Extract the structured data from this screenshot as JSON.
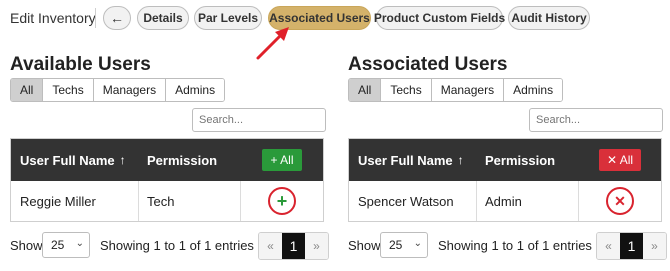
{
  "topbar": {
    "page_label": "Edit Inventory",
    "back_glyph": "←",
    "tabs": [
      {
        "label": "Details",
        "active": false
      },
      {
        "label": "Par Levels",
        "active": false
      },
      {
        "label": "Associated Users",
        "active": true
      },
      {
        "label": "Product Custom Fields",
        "active": false
      },
      {
        "label": "Audit History",
        "active": false
      }
    ],
    "active_color": "#d4b26a"
  },
  "annotation": {
    "icon": "red-arrow-icon",
    "color": "#e0202a"
  },
  "available": {
    "title": "Available Users",
    "filters": [
      "All",
      "Techs",
      "Managers",
      "Admins"
    ],
    "selected_filter": "All",
    "search_placeholder": "Search...",
    "columns": {
      "name": "User Full Name",
      "sort_glyph": "↑",
      "permission": "Permission"
    },
    "bulk_button": "+ All",
    "rows": [
      {
        "name": "Reggie Miller",
        "permission": "Tech",
        "action_icon": "add-icon",
        "action_glyph": "+"
      }
    ],
    "footer": {
      "show_label": "Show",
      "page_size": "25",
      "chevron": "⌄",
      "entries": "Showing 1 to 1 of 1 entries",
      "prev": "«",
      "current_page": "1",
      "next": "»"
    }
  },
  "associated": {
    "title": "Associated Users",
    "filters": [
      "All",
      "Techs",
      "Managers",
      "Admins"
    ],
    "selected_filter": "All",
    "search_placeholder": "Search...",
    "columns": {
      "name": "User Full Name",
      "sort_glyph": "↑",
      "permission": "Permission"
    },
    "bulk_button": "✕ All",
    "rows": [
      {
        "name": "Spencer Watson",
        "permission": "Admin",
        "action_icon": "remove-icon",
        "action_glyph": "✕"
      }
    ],
    "footer": {
      "show_label": "Show",
      "page_size": "25",
      "chevron": "⌄",
      "entries": "Showing 1 to 1 of 1 entries",
      "prev": "«",
      "current_page": "1",
      "next": "»"
    }
  },
  "colors": {
    "header_bg": "#333333",
    "add_green": "#2a9a3a",
    "remove_red": "#d9303a",
    "highlight_circle": "#d9232e"
  }
}
